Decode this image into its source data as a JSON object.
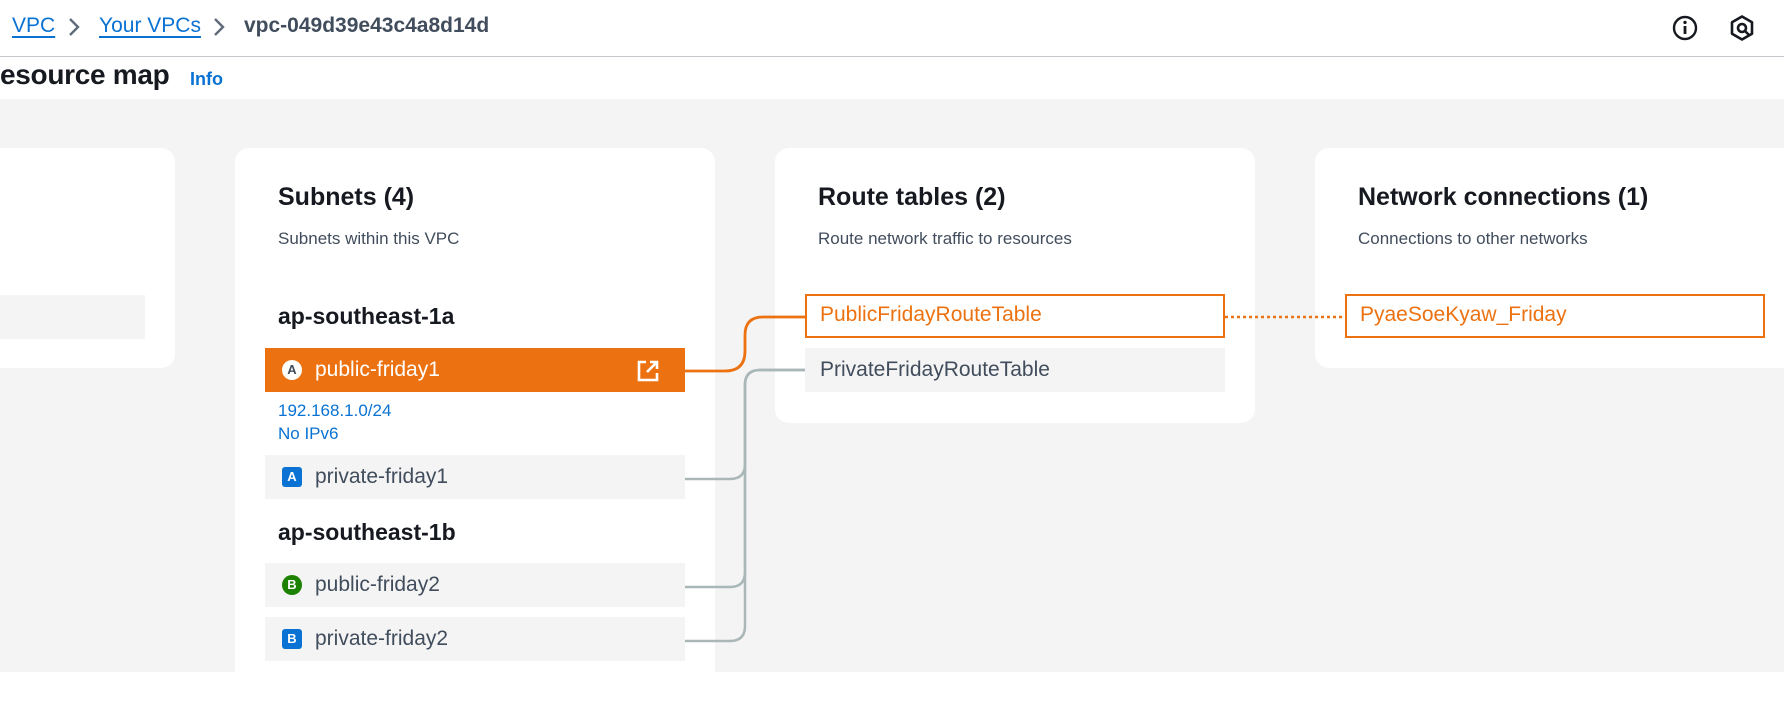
{
  "breadcrumb": {
    "items": [
      {
        "label": "VPC"
      },
      {
        "label": "Your VPCs"
      },
      {
        "label": "vpc-049d39e43c4a8d14d"
      }
    ]
  },
  "header_icons": [
    "info-circle-icon",
    "settings-hexagon-icon"
  ],
  "page": {
    "title": "esource map",
    "info_label": "Info"
  },
  "subnets": {
    "title": "Subnets (4)",
    "subtitle": "Subnets within this VPC",
    "zones": [
      {
        "name": "ap-southeast-1a",
        "subnets": [
          {
            "badge": "A",
            "name": "public-friday1",
            "type": "public",
            "cidr": "192.168.1.0/24",
            "ipv6": "No IPv6",
            "selected": true
          },
          {
            "badge": "A",
            "name": "private-friday1",
            "type": "private"
          }
        ]
      },
      {
        "name": "ap-southeast-1b",
        "subnets": [
          {
            "badge": "B",
            "name": "public-friday2",
            "type": "public"
          },
          {
            "badge": "B",
            "name": "private-friday2",
            "type": "private"
          }
        ]
      }
    ]
  },
  "route_tables": {
    "title": "Route tables (2)",
    "subtitle": "Route network traffic to resources",
    "items": [
      {
        "name": "PublicFridayRouteTable",
        "highlighted": true
      },
      {
        "name": "PrivateFridayRouteTable",
        "highlighted": false
      }
    ]
  },
  "network_connections": {
    "title": "Network connections (1)",
    "subtitle": "Connections to other networks",
    "items": [
      {
        "name": "PyaeSoeKyaw_Friday",
        "highlighted": true
      }
    ]
  },
  "colors": {
    "accent": "#ec7211",
    "link": "#0972d3",
    "connector": "#aab7b8",
    "public_badge": "#1d8102",
    "private_badge": "#0972d3"
  }
}
